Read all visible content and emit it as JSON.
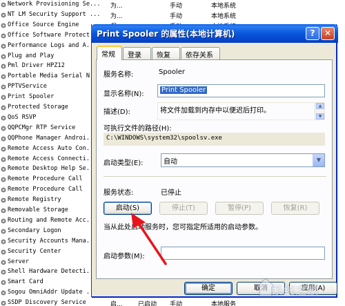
{
  "services": [
    {
      "name": "Network Provisioning Se...",
      "description": "为...",
      "status": "",
      "startup": "手动",
      "logon": "本地系统"
    },
    {
      "name": "NT LM Security Support ...",
      "description": "为...",
      "status": "",
      "startup": "手动",
      "logon": "本地系统"
    },
    {
      "name": "Office  Source Engine",
      "description": "保...",
      "status": "",
      "startup": "手动",
      "logon": "本地系统"
    },
    {
      "name": "Office Software Protect...",
      "description": "",
      "status": "",
      "startup": "",
      "logon": ""
    },
    {
      "name": "Performance Logs and A...",
      "description": "",
      "status": "",
      "startup": "",
      "logon": ""
    },
    {
      "name": "Plug and Play",
      "description": "",
      "status": "",
      "startup": "",
      "logon": ""
    },
    {
      "name": "Pml Driver HPZ12",
      "description": "",
      "status": "",
      "startup": "",
      "logon": ""
    },
    {
      "name": "Portable Media Serial N...",
      "description": "",
      "status": "",
      "startup": "",
      "logon": ""
    },
    {
      "name": "PPTVService",
      "description": "",
      "status": "",
      "startup": "",
      "logon": ""
    },
    {
      "name": "Print Spooler",
      "description": "",
      "status": "",
      "startup": "",
      "logon": ""
    },
    {
      "name": "Protected Storage",
      "description": "",
      "status": "",
      "startup": "",
      "logon": ""
    },
    {
      "name": "QoS RSVP",
      "description": "",
      "status": "",
      "startup": "",
      "logon": ""
    },
    {
      "name": "QQPCMgr RTP Service",
      "description": "",
      "status": "",
      "startup": "",
      "logon": ""
    },
    {
      "name": "QQPhone Manager Androi...",
      "description": "",
      "status": "",
      "startup": "",
      "logon": ""
    },
    {
      "name": "Remote Access Auto Con...",
      "description": "",
      "status": "",
      "startup": "",
      "logon": ""
    },
    {
      "name": "Remote Access Connecti...",
      "description": "",
      "status": "",
      "startup": "",
      "logon": ""
    },
    {
      "name": "Remote Desktop Help Se...",
      "description": "",
      "status": "",
      "startup": "",
      "logon": ""
    },
    {
      "name": "Remote Procedure Call",
      "description": "",
      "status": "",
      "startup": "",
      "logon": ""
    },
    {
      "name": "Remote Procedure Call",
      "description": "",
      "status": "",
      "startup": "",
      "logon": ""
    },
    {
      "name": "Remote Registry",
      "description": "",
      "status": "",
      "startup": "",
      "logon": ""
    },
    {
      "name": "Removable Storage",
      "description": "",
      "status": "",
      "startup": "",
      "logon": ""
    },
    {
      "name": "Routing and Remote Acc...",
      "description": "",
      "status": "",
      "startup": "",
      "logon": ""
    },
    {
      "name": "Secondary Logon",
      "description": "",
      "status": "",
      "startup": "",
      "logon": ""
    },
    {
      "name": "Security Accounts Mana...",
      "description": "",
      "status": "",
      "startup": "",
      "logon": ""
    },
    {
      "name": "Security Center",
      "description": "",
      "status": "",
      "startup": "",
      "logon": ""
    },
    {
      "name": "Server",
      "description": "",
      "status": "",
      "startup": "",
      "logon": ""
    },
    {
      "name": "Shell Hardware Detecti...",
      "description": "",
      "status": "",
      "startup": "",
      "logon": ""
    },
    {
      "name": "Smart Card",
      "description": "",
      "status": "",
      "startup": "",
      "logon": ""
    },
    {
      "name": "Sogou OmniAddr Update ...",
      "description": "",
      "status": "",
      "startup": "",
      "logon": ""
    },
    {
      "name": "SSDP Discovery Service",
      "description": "启...",
      "status": "已启动",
      "startup": "手动",
      "logon": "本地服务"
    }
  ],
  "dialog": {
    "title": "Print Spooler 的属性(本地计算机)",
    "help_glyph": "?",
    "close_glyph": "✕",
    "tabs": [
      "常规",
      "登录",
      "恢复",
      "依存关系"
    ],
    "active_tab": "常规",
    "service_name_label": "服务名称:",
    "service_name_value": "Spooler",
    "display_name_label": "显示名称(N):",
    "display_name_value": "Print Spooler",
    "description_label": "描述(D):",
    "description_value": "将文件加载到内存中以便迟后打印。",
    "exe_path_label": "可执行文件的路径(H):",
    "exe_path_value": "C:\\WINDOWS\\system32\\spoolsv.exe",
    "startup_type_label": "启动类型(E):",
    "startup_type_value": "自动",
    "service_status_label": "服务状态:",
    "service_status_value": "已停止",
    "start_button": "启动(S)",
    "stop_button": "停止(T)",
    "pause_button": "暂停(P)",
    "resume_button": "恢复(R)",
    "hint_text": "当从此处启动服务时，您可指定所适用的启动参数。",
    "start_params_label": "启动参数(M):",
    "start_params_value": "",
    "ok_button": "确定",
    "cancel_button": "取消",
    "apply_button": "应用(A)"
  },
  "annotation": {
    "arrow_color": "#e8141b"
  },
  "watermark": {
    "text": "系统之家"
  },
  "colors": {
    "titlebar": "#0b5bdc",
    "dialog_bg": "#ece9d8",
    "selection": "#316ac5"
  }
}
